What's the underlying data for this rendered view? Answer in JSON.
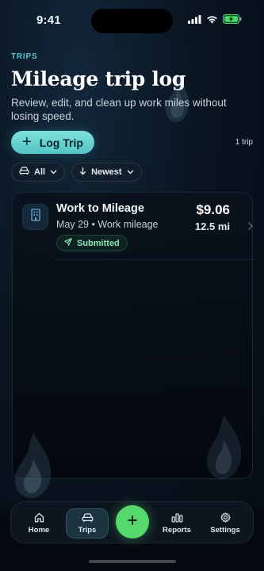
{
  "status_bar": {
    "time": "9:41"
  },
  "header": {
    "eyebrow": "TRIPS",
    "title": "Mileage trip log",
    "subtitle": "Review, edit, and clean up work miles without losing speed."
  },
  "actions": {
    "log_trip_label": "Log Trip",
    "trip_count": "1 trip"
  },
  "filters": {
    "vehicle_filter": "All",
    "sort_filter": "Newest"
  },
  "trips": [
    {
      "name": "Work to Mileage",
      "meta": "May 29 • Work mileage",
      "status": "Submitted",
      "amount": "$9.06",
      "distance": "12.5 mi",
      "icon": "building-icon"
    }
  ],
  "tab_bar": {
    "home": "Home",
    "trips": "Trips",
    "reports": "Reports",
    "settings": "Settings",
    "active": "trips"
  },
  "colors": {
    "accent": "#57c6cf",
    "button": "#6fd8d4",
    "fab": "#55d96c",
    "badge_text": "#8fe3b4",
    "battery": "#4cd964"
  }
}
